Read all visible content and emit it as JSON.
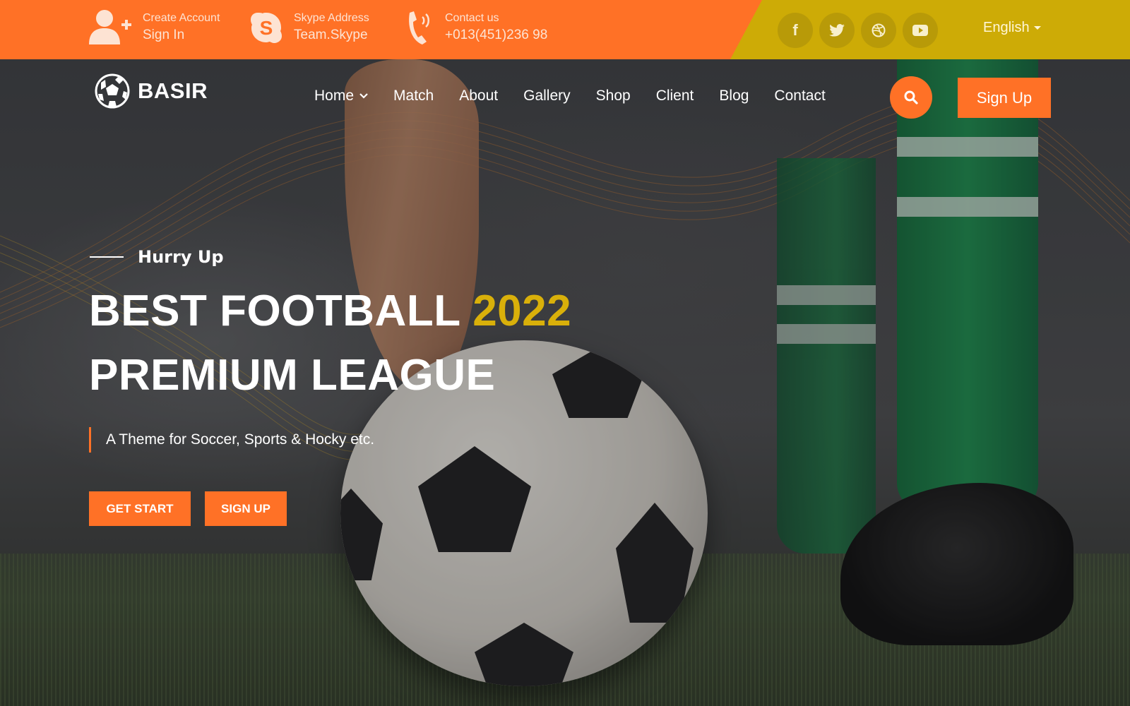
{
  "topbar": {
    "account": {
      "line1": "Create Account",
      "line2": "Sign In",
      "icon": "user-plus-icon"
    },
    "skype": {
      "line1": "Skype Address",
      "line2": "Team.Skype",
      "icon": "skype-icon"
    },
    "contact": {
      "line1": "Contact us",
      "line2": "+013(451)236 98",
      "icon": "phone-icon"
    },
    "social": [
      {
        "name": "facebook",
        "glyph": "f"
      },
      {
        "name": "twitter",
        "glyph": "t"
      },
      {
        "name": "dribbble",
        "glyph": "d"
      },
      {
        "name": "youtube",
        "glyph": "y"
      }
    ],
    "language": "English"
  },
  "header": {
    "logo_text": "BASIR",
    "nav": [
      {
        "label": "Home",
        "has_dropdown": true
      },
      {
        "label": "Match"
      },
      {
        "label": "About"
      },
      {
        "label": "Gallery"
      },
      {
        "label": "Shop"
      },
      {
        "label": "Client"
      },
      {
        "label": "Blog"
      },
      {
        "label": "Contact"
      }
    ],
    "signup_label": "Sign Up"
  },
  "hero": {
    "kicker": "Hurry Up",
    "title_line1": "BEST FOOTBALL",
    "title_accent": "2022",
    "title_line2": "PREMIUM LEAGUE",
    "tagline": "A Theme for Soccer, Sports & Hocky etc.",
    "cta_primary": "GET START",
    "cta_secondary": "SIGN UP"
  },
  "colors": {
    "primary": "#ff7126",
    "accent": "#cdab06",
    "text": "#ffffff"
  }
}
